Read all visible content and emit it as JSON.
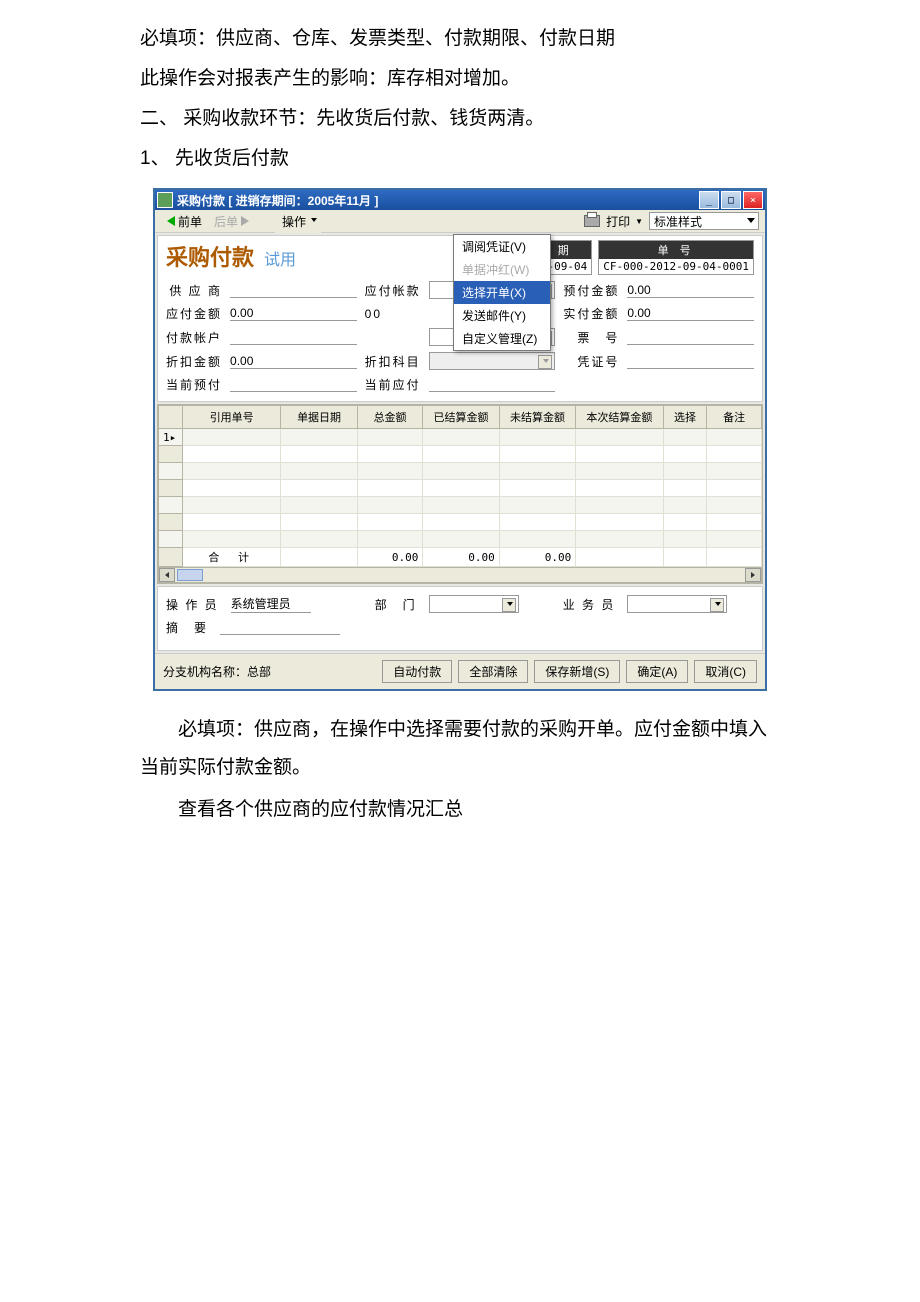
{
  "doc": {
    "p1": "必填项：供应商、仓库、发票类型、付款期限、付款日期",
    "p2": "此操作会对报表产生的影响：库存相对增加。",
    "p3": "二、 采购收款环节：先收货后付款、钱货两清。",
    "p4": "1、 先收货后付款",
    "p5": "必填项：供应商，在操作中选择需要付款的采购开单。应付金额中填入当前实际付款金额。",
    "p6": "查看各个供应商的应付款情况汇总"
  },
  "window": {
    "title": "采购付款 [ 进销存期间：2005年11月 ]",
    "toolbar": {
      "prev": "前单",
      "next": "后单",
      "operate": "操作",
      "print": "打印",
      "style": "标准样式"
    },
    "opmenu": {
      "m1": "调阅凭证(V)",
      "m2": "单据冲红(W)",
      "m3": "选择开单(X)",
      "m4": "发送邮件(Y)",
      "m5": "自定义管理(Z)"
    },
    "form": {
      "title": "采购付款",
      "trial": "试用",
      "date_hdr": "日 期",
      "num_hdr": "单 号",
      "date_val": "2012-09-04",
      "num_val": "CF-000-2012-09-04-0001",
      "supplier_lbl": "供 应 商",
      "acct_type_lbl": "应付帐款",
      "prepay_amt_lbl": "预付金额",
      "prepay_amt_val": "0.00",
      "payable_lbl": "应付金额",
      "payable_val": "0.00",
      "peek_val": "00",
      "actual_lbl": "实付金额",
      "actual_val": "0.00",
      "pay_acct_lbl": "付款帐户",
      "bill_no_lbl": "票　号",
      "discount_lbl": "折扣金额",
      "discount_val": "0.00",
      "discount_subj_lbl": "折扣科目",
      "voucher_lbl": "凭证号",
      "cur_prepay_lbl": "当前预付",
      "cur_payable_lbl": "当前应付"
    },
    "table": {
      "c1": "引用单号",
      "c2": "单据日期",
      "c3": "总金额",
      "c4": "已结算金额",
      "c5": "未结算金额",
      "c6": "本次结算金额",
      "c7": "选择",
      "c8": "备注",
      "row1": "1",
      "total_lbl": "合 计",
      "total_v3": "0.00",
      "total_v4": "0.00",
      "total_v5": "0.00"
    },
    "footer": {
      "operator_lbl": "操 作 员",
      "operator_val": "系统管理员",
      "dept_lbl": "部　门",
      "salesman_lbl": "业 务 员",
      "summary_lbl": "摘　要"
    },
    "status": {
      "branch": "分支机构名称：总部",
      "auto_pay": "自动付款",
      "clear_all": "全部清除",
      "save_new": "保存新增(S)",
      "ok": "确定(A)",
      "cancel": "取消(C)"
    }
  }
}
